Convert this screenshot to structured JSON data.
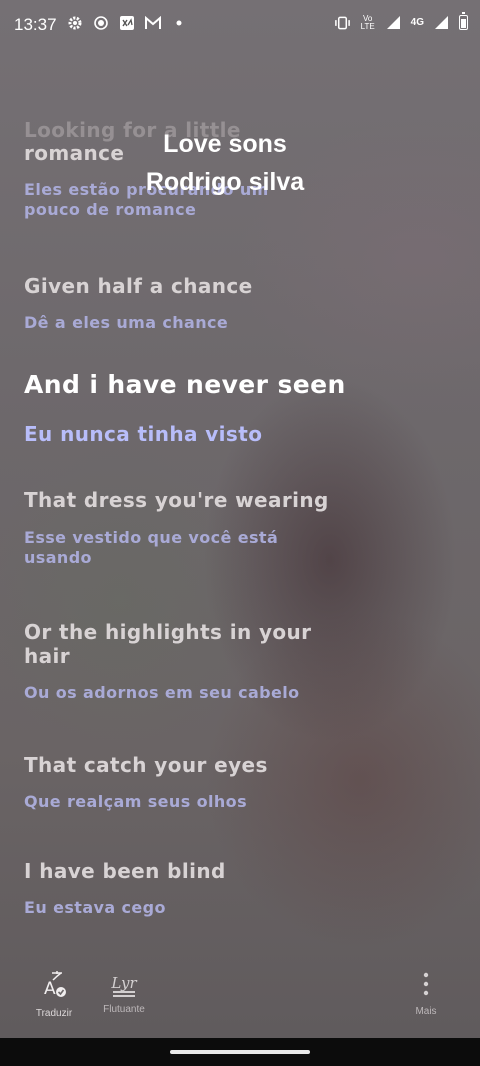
{
  "status_bar": {
    "time": "13:37",
    "lte_label": "Vo¹⁄₄\nLTE",
    "network": "4G"
  },
  "song": {
    "title": "Love sons",
    "artist": "Rodrigo silva"
  },
  "lyrics": [
    {
      "en": "Looking for a little",
      "pt": ""
    },
    {
      "en": "romance",
      "pt": "Eles estão procurando um pouco de romance"
    },
    {
      "en": "Given half a chance",
      "pt": "Dê a eles uma chance"
    },
    {
      "en": "And i have never seen",
      "pt": "Eu nunca tinha visto"
    },
    {
      "en": "That dress you're wearing",
      "pt": "Esse vestido que você está usando"
    },
    {
      "en": "Or the highlights in your hair",
      "pt": "Ou os adornos em seu cabelo"
    },
    {
      "en": "That catch your eyes",
      "pt": "Que realçam seus olhos"
    },
    {
      "en": "I have been blind",
      "pt": "Eu estava cego"
    }
  ],
  "bottom_bar": {
    "translate_label": "Traduzir",
    "floating_label": "Flutuante",
    "floating_icon_text": "Lyr",
    "more_label": "Mais"
  },
  "colors": {
    "active_line": "#ffffff",
    "active_translation": "#b8bdfa",
    "translation": "#a9aad6"
  }
}
